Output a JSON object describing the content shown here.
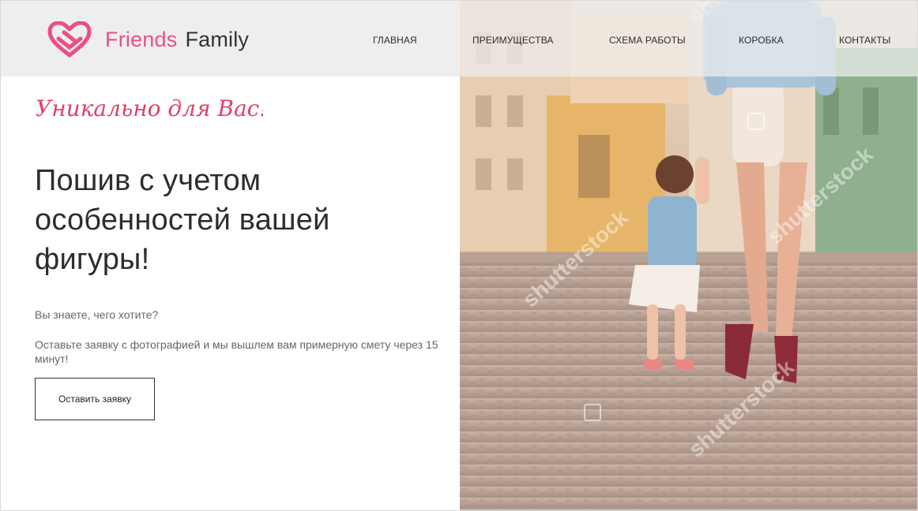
{
  "brand": {
    "name_part1": "Friends",
    "name_part2": "Family",
    "accent_color": "#ec4f82",
    "logo_icon": "heart-logo-icon"
  },
  "nav": {
    "items": [
      {
        "label": "ГЛАВНАЯ"
      },
      {
        "label": "ПРЕИМУЩЕСТВА"
      },
      {
        "label": "СХЕМА РАБОТЫ"
      },
      {
        "label": "КОРОБКА"
      },
      {
        "label": "КОНТАКТЫ"
      }
    ]
  },
  "hero": {
    "tagline": "Уникально для Вас!",
    "headline_line1": "Пошив с учетом",
    "headline_line2": "особенностей вашей",
    "headline_line3": "фигуры!",
    "question": "Вы знаете, чего хотите?",
    "description": "Оставьте заявку с фотографией и мы вышлем вам примерную смету через 15 минут!",
    "cta_label": "Оставить заявку",
    "watermark_text": "shutterstock",
    "image_subject": "mother-and-child-street-photo"
  }
}
